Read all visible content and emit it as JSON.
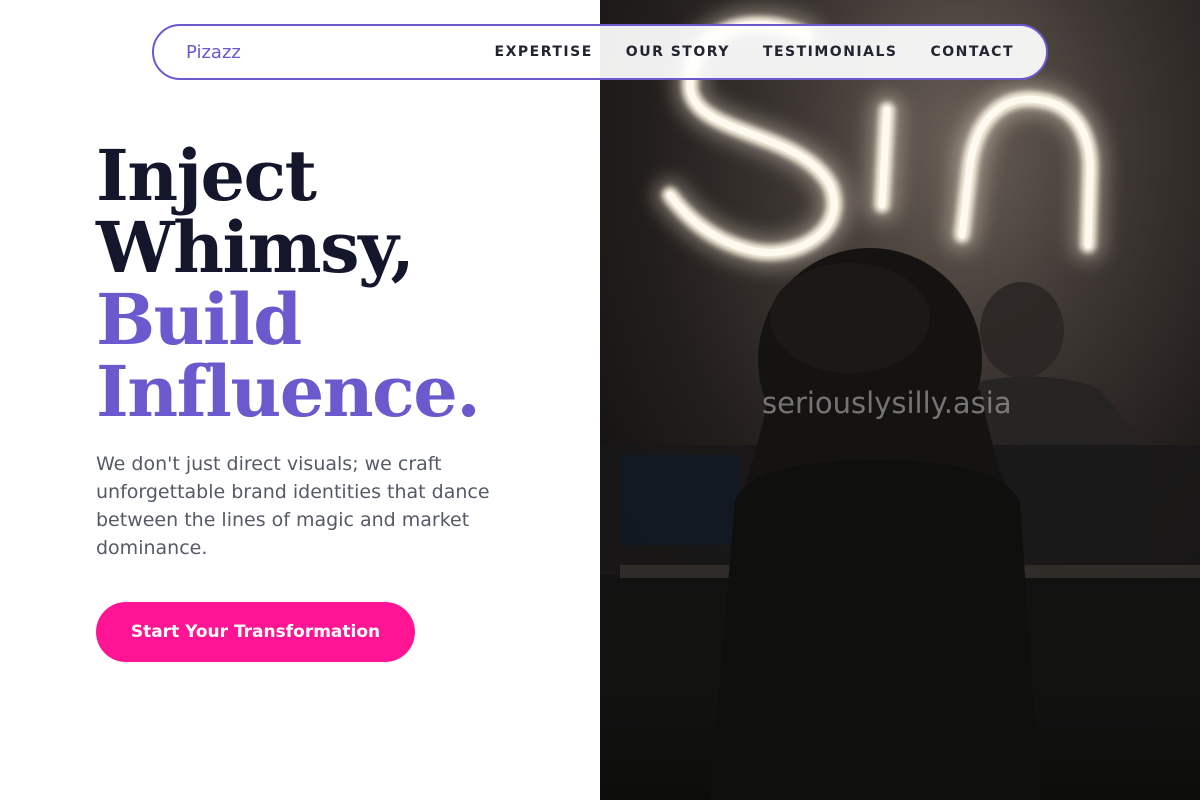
{
  "nav": {
    "brand": "Pizazz",
    "links": [
      "EXPERTISE",
      "OUR STORY",
      "TESTIMONIALS",
      "CONTACT"
    ]
  },
  "hero": {
    "headline_line1": "Inject",
    "headline_line2": "Whimsy,",
    "headline_line3": "Build",
    "headline_line4": "Influence.",
    "subtext": "We don't just direct visuals; we craft unforgettable brand identities that dance between the lines of magic and market dominance.",
    "cta_label": "Start Your Transformation"
  },
  "photo": {
    "neon_sign_text": "Sin",
    "watermark": "seriouslysilly.asia"
  },
  "colors": {
    "accent_purple": "#6a5acd",
    "cta_pink": "#ff1493",
    "headline_dark": "#14162b",
    "body_text": "#555a66"
  }
}
